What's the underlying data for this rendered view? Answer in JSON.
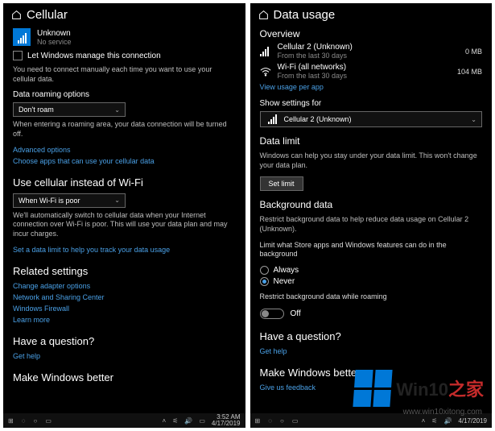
{
  "left": {
    "title": "Cellular",
    "network_name": "Unknown",
    "network_status": "No service",
    "manage_checkbox_label": "Let Windows manage this connection",
    "manual_desc": "You need to connect manually each time you want to use your cellular data.",
    "roaming_heading": "Data roaming options",
    "roaming_value": "Don't roam",
    "roaming_desc": "When entering a roaming area, your data connection will be turned off.",
    "advanced_link": "Advanced options",
    "choose_apps_link": "Choose apps that can use your cellular data",
    "use_cellular_heading": "Use cellular instead of Wi-Fi",
    "use_cellular_value": "When Wi-Fi is poor",
    "use_cellular_desc": "We'll automatically switch to cellular data when your Internet connection over Wi-Fi is poor. This will use your data plan and may incur charges.",
    "data_limit_link": "Set a data limit to help you track your data usage",
    "related_heading": "Related settings",
    "related_links": [
      "Change adapter options",
      "Network and Sharing Center",
      "Windows Firewall",
      "Learn more"
    ],
    "question_heading": "Have a question?",
    "gethelp_link": "Get help",
    "better_heading": "Make Windows better",
    "taskbar_time": "3:52 AM",
    "taskbar_date": "4/17/2019"
  },
  "right": {
    "title": "Data usage",
    "overview_heading": "Overview",
    "cellular_label": "Cellular 2 (Unknown)",
    "cellular_sub": "From the last 30 days",
    "cellular_value": "0 MB",
    "wifi_label": "Wi-Fi (all networks)",
    "wifi_sub": "From the last 30 days",
    "wifi_value": "104 MB",
    "view_per_app_link": "View usage per app",
    "show_settings_heading": "Show settings for",
    "show_settings_value": "Cellular 2 (Unknown)",
    "data_limit_heading": "Data limit",
    "data_limit_desc": "Windows can help you stay under your data limit. This won't change your data plan.",
    "set_limit_btn": "Set limit",
    "background_heading": "Background data",
    "background_desc": "Restrict background data to help reduce data usage on Cellular 2 (Unknown).",
    "background_limit_label": "Limit what Store apps and Windows features can do in the background",
    "radio_always": "Always",
    "radio_never": "Never",
    "roaming_restrict_label": "Restrict background data while roaming",
    "toggle_off": "Off",
    "question_heading": "Have a question?",
    "gethelp_link": "Get help",
    "better_heading": "Make Windows better",
    "feedback_link": "Give us feedback",
    "taskbar_date": "4/17/2019"
  },
  "overlay": {
    "logo_text_prefix": "Win10",
    "logo_text_red": "之家",
    "site": "www.win10xitong.com"
  }
}
